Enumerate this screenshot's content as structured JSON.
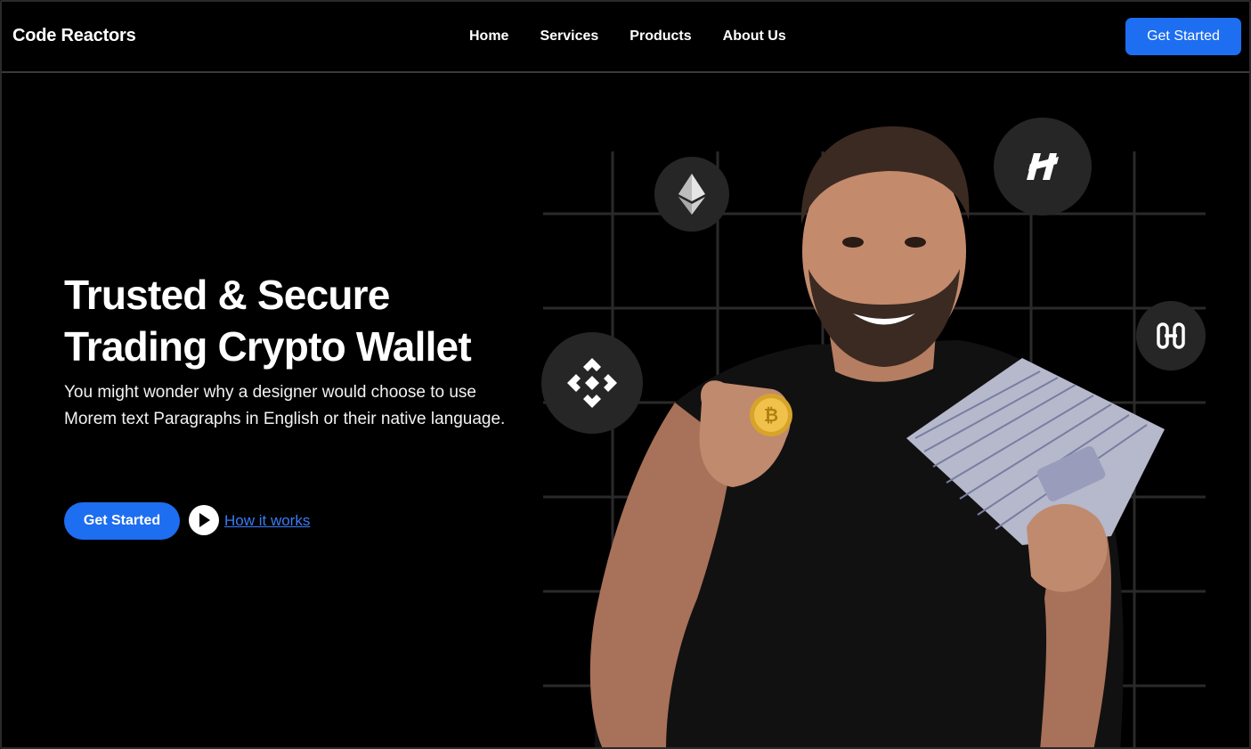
{
  "navbar": {
    "brand": "Code Reactors",
    "links": [
      "Home",
      "Services",
      "Products",
      "About Us"
    ],
    "cta_label": "Get Started"
  },
  "hero": {
    "title_line1": "Trusted & Secure",
    "title_line2": "Trading Crypto Wallet",
    "subtitle": "You might wonder why a designer would choose to use Morem text Paragraphs in English or their native language.",
    "cta_label": "Get Started",
    "how_link_label": "How it works"
  },
  "icons": {
    "ethereum": "ethereum-icon",
    "binance": "binance-icon",
    "harmony": "harmony-icon",
    "hedera": "hedera-icon",
    "play": "play-icon",
    "bitcoin": "bitcoin-coin-icon"
  },
  "colors": {
    "background": "#000000",
    "accent": "#1d6ef0",
    "link": "#3a7bf5",
    "badge": "#262626",
    "grid": "#2a2a2a"
  }
}
